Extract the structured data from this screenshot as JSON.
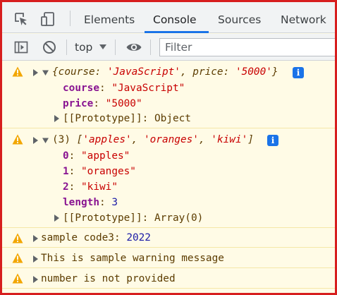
{
  "tabs": {
    "elements": "Elements",
    "console": "Console",
    "sources": "Sources",
    "network": "Network"
  },
  "toolbar": {
    "context": "top",
    "filter_placeholder": "Filter"
  },
  "colors": {
    "warning_bg": "#fffbe6",
    "warning_text": "#5c3c00",
    "accent": "#1a73e8",
    "key": "#881391",
    "string": "#c80000",
    "number": "#1a1aa6",
    "frame_border": "#d71e1e"
  },
  "icons": {
    "inspect": "inspect-element-icon",
    "device": "device-toolbar-icon",
    "sidebar": "show-sidebar-icon",
    "clear": "clear-console-icon",
    "eye": "live-expression-icon",
    "warning": "warning-icon",
    "info": "info-icon"
  },
  "messages": [
    {
      "summary": {
        "open": "{",
        "k1": "course",
        "v1": "'JavaScript'",
        "sep": ", ",
        "k2": "price",
        "v2": "'5000'",
        "close": "}"
      },
      "props": [
        {
          "key": "course",
          "value": "\"JavaScript\""
        },
        {
          "key": "price",
          "value": "\"5000\""
        }
      ],
      "prototype": {
        "label": "[[Prototype]]",
        "value": "Object"
      }
    },
    {
      "summary": {
        "count": "(3)",
        "open": "[",
        "v0": "'apples'",
        "v1": "'oranges'",
        "v2": "'kiwi'",
        "close": "]"
      },
      "props": [
        {
          "key": "0",
          "value": "\"apples\""
        },
        {
          "key": "1",
          "value": "\"oranges\""
        },
        {
          "key": "2",
          "value": "\"kiwi\""
        },
        {
          "key": "length",
          "value": "3"
        }
      ],
      "prototype": {
        "label": "[[Prototype]]",
        "value": "Array(0)"
      }
    },
    {
      "text": "sample code3:",
      "value": "2022"
    },
    {
      "text": "This is sample warning message"
    },
    {
      "text": "number is not provided"
    }
  ]
}
